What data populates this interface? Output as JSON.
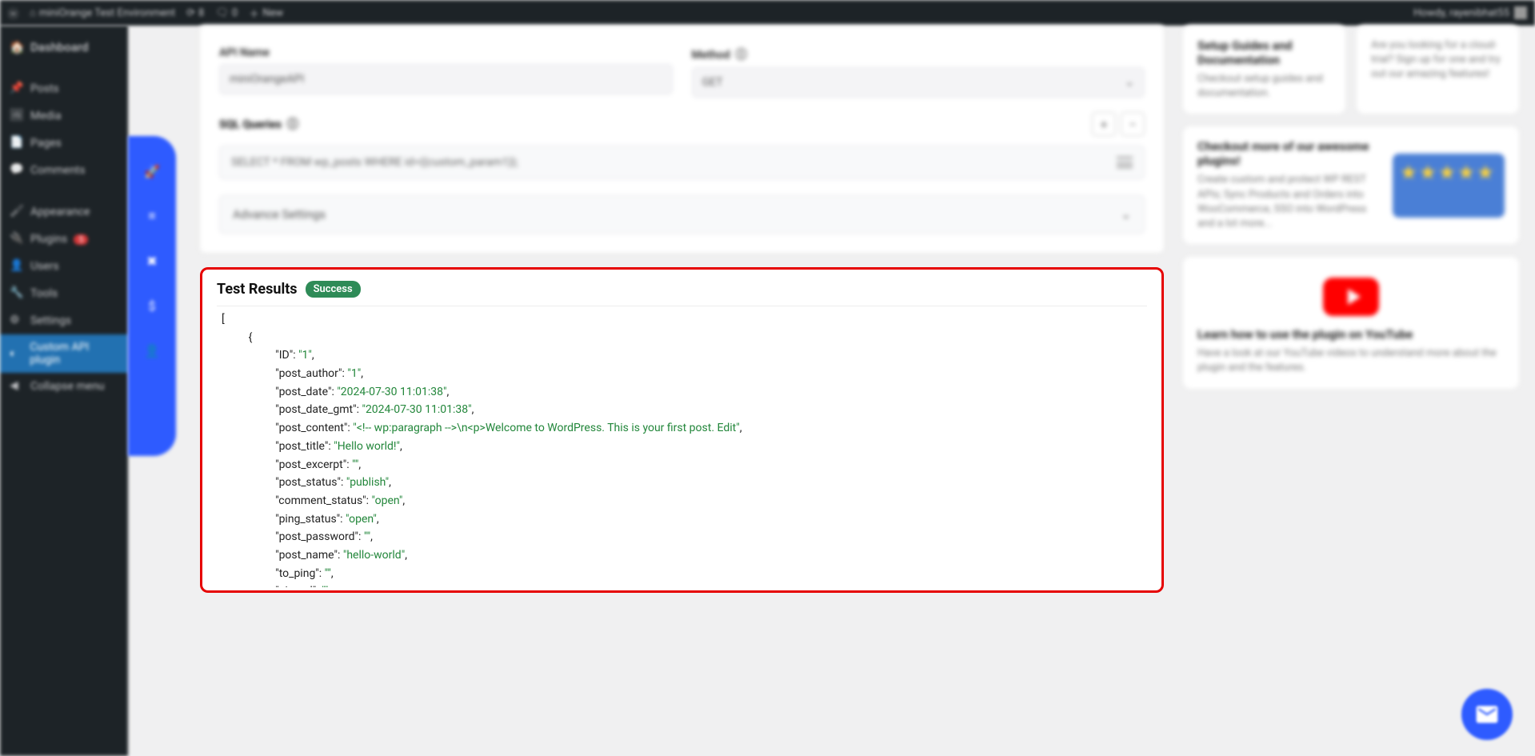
{
  "adminbar": {
    "site": "miniOrange Test Environment",
    "updates": "8",
    "comments": "0",
    "new": "New",
    "howdy": "Howdy, rayenibhat55"
  },
  "sidebar": {
    "items": [
      {
        "label": "Dashboard"
      },
      {
        "label": "Posts"
      },
      {
        "label": "Media"
      },
      {
        "label": "Pages"
      },
      {
        "label": "Comments"
      },
      {
        "label": "Appearance"
      },
      {
        "label": "Plugins",
        "badge": "5"
      },
      {
        "label": "Users"
      },
      {
        "label": "Tools"
      },
      {
        "label": "Settings"
      },
      {
        "label": "Custom API plugin"
      },
      {
        "label": "Collapse menu"
      }
    ]
  },
  "form": {
    "api_name_label": "API Name",
    "api_name_value": "miniOrangeAPI",
    "method_label": "Method",
    "method_value": "GET",
    "sql_label": "SQL Queries",
    "sql_value": "SELECT * FROM wp_posts WHERE id={{custom_param1}};",
    "advance_label": "Advance Settings"
  },
  "results": {
    "title": "Test Results",
    "status": "Success",
    "json": [
      {
        "key": "ID",
        "val": "1"
      },
      {
        "key": "post_author",
        "val": "1"
      },
      {
        "key": "post_date",
        "val": "2024-07-30 11:01:38"
      },
      {
        "key": "post_date_gmt",
        "val": "2024-07-30 11:01:38"
      },
      {
        "key": "post_content",
        "val": "<!-- wp:paragraph -->\\n<p>Welcome to WordPress. This is your first post. Edit"
      },
      {
        "key": "post_title",
        "val": "Hello world!"
      },
      {
        "key": "post_excerpt",
        "val": ""
      },
      {
        "key": "post_status",
        "val": "publish"
      },
      {
        "key": "comment_status",
        "val": "open"
      },
      {
        "key": "ping_status",
        "val": "open"
      },
      {
        "key": "post_password",
        "val": ""
      },
      {
        "key": "post_name",
        "val": "hello-world"
      },
      {
        "key": "to_ping",
        "val": ""
      },
      {
        "key": "pinged",
        "val": ""
      }
    ]
  },
  "side": {
    "guides_title": "Setup Guides and Documentation",
    "guides_desc": "Checkout setup guides and documentation.",
    "cloud_desc": "Are you looking for a cloud-trial? Sign up for one and try out our amazing features!",
    "plugins_title": "Checkout more of our awesome plugins!",
    "plugins_desc": "Create custom and protect WP REST APIs; Sync Products and Orders into WooCommerce, SSO into WordPress and a lot more...",
    "yt_title": "Learn how to use the plugin on YouTube",
    "yt_desc": "Have a look at our YouTube videos to understand more about the plugin and the features."
  }
}
